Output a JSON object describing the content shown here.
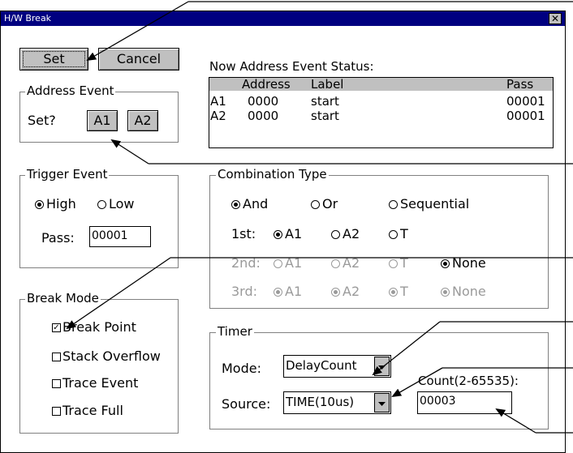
{
  "window": {
    "title": "H/W Break",
    "close_glyph": "✕"
  },
  "buttons": {
    "set": "Set",
    "cancel": "Cancel"
  },
  "address_event": {
    "legend": "Address Event",
    "set_label": "Set?",
    "a1": "A1",
    "a2": "A2"
  },
  "status": {
    "title": "Now Address Event Status:",
    "headers": {
      "address": "Address",
      "label": "Label",
      "pass": "Pass"
    },
    "rows": [
      {
        "name": "A1",
        "address": "0000",
        "label": "start",
        "pass": "00001"
      },
      {
        "name": "A2",
        "address": "0000",
        "label": "start",
        "pass": "00001"
      }
    ]
  },
  "trigger": {
    "legend": "Trigger Event",
    "high": "High",
    "low": "Low",
    "pass_label": "Pass:",
    "pass_value": "00001",
    "selected": "High"
  },
  "combination": {
    "legend": "Combination Type",
    "and": "And",
    "or": "Or",
    "sequential": "Sequential",
    "first": {
      "label": "1st:",
      "a1": "A1",
      "a2": "A2",
      "t": "T"
    },
    "second": {
      "label": "2nd:",
      "a1": "A1",
      "a2": "A2",
      "t": "T",
      "none": "None"
    },
    "third": {
      "label": "3rd:",
      "a1": "A1",
      "a2": "A2",
      "t": "T",
      "none": "None"
    }
  },
  "break_mode": {
    "legend": "Break Mode",
    "break_point": "Break Point",
    "stack_overflow": "Stack Overflow",
    "trace_event": "Trace Event",
    "trace_full": "Trace Full",
    "checked_glyph": "✓"
  },
  "timer": {
    "legend": "Timer",
    "mode_label": "Mode:",
    "mode_value": "DelayCount",
    "source_label": "Source:",
    "source_value": "TIME(10us)",
    "count_label": "Count(2-65535):",
    "count_value": "00003"
  }
}
